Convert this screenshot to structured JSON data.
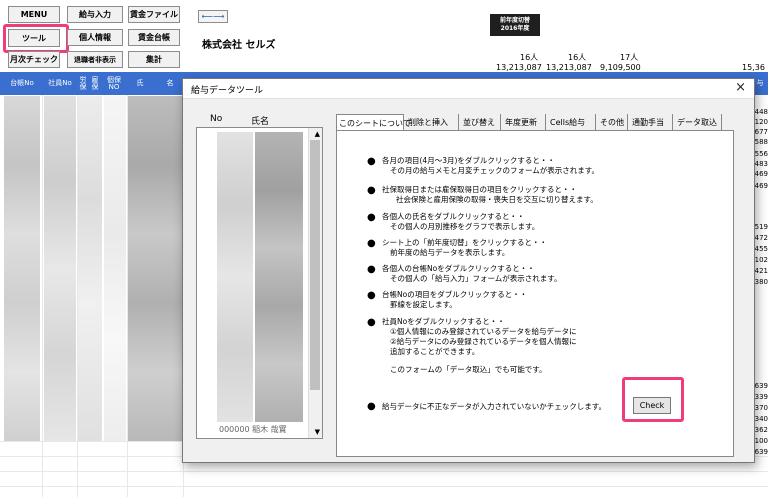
{
  "toolbar": {
    "menu": "MENU",
    "payroll_input": "給与入力",
    "wage_file": "賃金ファイル",
    "tool": "ツール",
    "personal_info": "個人情報",
    "wage_ledger": "賃金台帳",
    "monthly_check": "月次チェック",
    "hide_retired": "退職者非表示",
    "total": "集計"
  },
  "header": {
    "company": "株式会社 セルズ",
    "prev_year_line1": "前年度切替",
    "prev_year_line2": "2016年度",
    "mini_tab": "⟵⟶",
    "counts": [
      "16人",
      "16人",
      "17人"
    ],
    "amounts": [
      "13,213,087",
      "13,213,087",
      "9,109,500",
      "15,36"
    ]
  },
  "columns": {
    "ledger_no": "台帳No",
    "employee_no": "社員No",
    "c3": "労保",
    "c4": "雇保",
    "c5": "個保NO",
    "name1": "氏",
    "name2": "名",
    "far_right": "与"
  },
  "right_numbers": [
    "448",
    "120",
    "677",
    "588",
    "556",
    "483",
    "469",
    "469",
    "519",
    "472",
    "455",
    "102",
    "421",
    "380",
    "639",
    "339",
    "370",
    "340",
    "362",
    "100",
    "639"
  ],
  "dialog": {
    "title": "給与データツール",
    "close": "×",
    "list_no_header": "No",
    "list_name_header": "氏名",
    "list_bottom_text": "000000 稲木 哉實",
    "tabs": [
      "このシートについて",
      "削除と挿入",
      "並び替え",
      "年度更新",
      "Cells給与",
      "その他",
      "通勤手当",
      "データ取込"
    ],
    "bullets": [
      {
        "line1": "各月の項目(4月～3月)をダブルクリックすると・・",
        "line2": "その月の給与メモと月変チェックのフォームが表示されます。"
      },
      {
        "line1": "社保取得日または雇保取得日の項目をクリックすると・・",
        "line2": "社会保険と雇用保険の取得・喪失日を交互に切り替えます。"
      },
      {
        "line1": "各個人の氏名をダブルクリックすると・・",
        "line2": "その個人の月別推移をグラフで表示します。"
      },
      {
        "line1": "シート上の「前年度切替」をクリックすると・・",
        "line2": "前年度の給与データを表示します。"
      },
      {
        "line1": "各個人の台帳Noをダブルクリックすると・・",
        "line2": "その個人の「給与入力」フォームが表示されます。"
      },
      {
        "line1": "台帳Noの項目をダブルクリックすると・・",
        "line2": "罫線を設定します。"
      }
    ],
    "employee_bullet": {
      "line1": "社員Noをダブルクリックすると・・",
      "line2": "①個人情報にのみ登録されているデータを給与データに",
      "line3": "②給与データにのみ登録されているデータを個人情報に",
      "line4": "追加することができます。",
      "line5": "このフォームの「データ取込」でも可能です。"
    },
    "check_text": "給与データに不正なデータが入力されていないかチェックします。",
    "check_button": "Check",
    "bullet_glyph": "●"
  },
  "colors": {
    "header_blue": "#3a6fcf",
    "highlight": "#f03c78"
  }
}
